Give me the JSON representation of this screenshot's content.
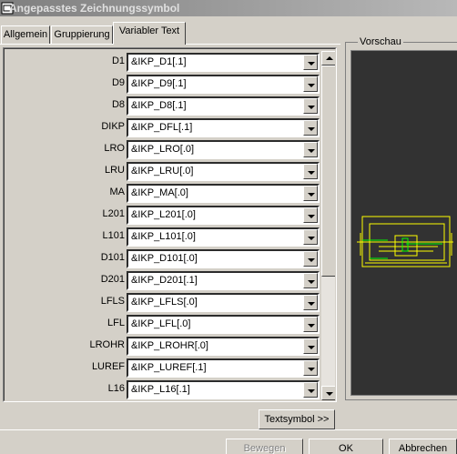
{
  "window": {
    "title": "Angepasstes Zeichnungssymbol"
  },
  "tabs": [
    {
      "label": "Allgemein"
    },
    {
      "label": "Gruppierung"
    },
    {
      "label": "Variabler Text",
      "active": true
    }
  ],
  "rows": [
    {
      "label": "D1",
      "value": "&IKP_D1[.1]"
    },
    {
      "label": "D9",
      "value": "&IKP_D9[.1]"
    },
    {
      "label": "D8",
      "value": "&IKP_D8[.1]"
    },
    {
      "label": "DIKP",
      "value": "&IKP_DFL[.1]"
    },
    {
      "label": "LRO",
      "value": "&IKP_LRO[.0]"
    },
    {
      "label": "LRU",
      "value": "&IKP_LRU[.0]"
    },
    {
      "label": "MA",
      "value": "&IKP_MA[.0]"
    },
    {
      "label": "L201",
      "value": "&IKP_L201[.0]"
    },
    {
      "label": "L101",
      "value": "&IKP_L101[.0]"
    },
    {
      "label": "D101",
      "value": "&IKP_D101[.0]"
    },
    {
      "label": "D201",
      "value": "&IKP_D201[.1]"
    },
    {
      "label": "LFLS",
      "value": "&IKP_LFLS[.0]"
    },
    {
      "label": "LFL",
      "value": "&IKP_LFL[.0]"
    },
    {
      "label": "LROHR",
      "value": "&IKP_LROHR[.0]"
    },
    {
      "label": "LUREF",
      "value": "&IKP_LUREF[.1]"
    },
    {
      "label": "L16",
      "value": "&IKP_L16[.1]"
    }
  ],
  "buttons": {
    "textsymbol": "Textsymbol >>",
    "bewegen": "Bewegen",
    "ok": "OK",
    "abbrechen": "Abbrechen"
  },
  "preview": {
    "title": "Vorschau"
  },
  "colors": {
    "preview_bg": "#323232",
    "preview_stroke": "#ffff00",
    "preview_accent": "#00ff00"
  }
}
